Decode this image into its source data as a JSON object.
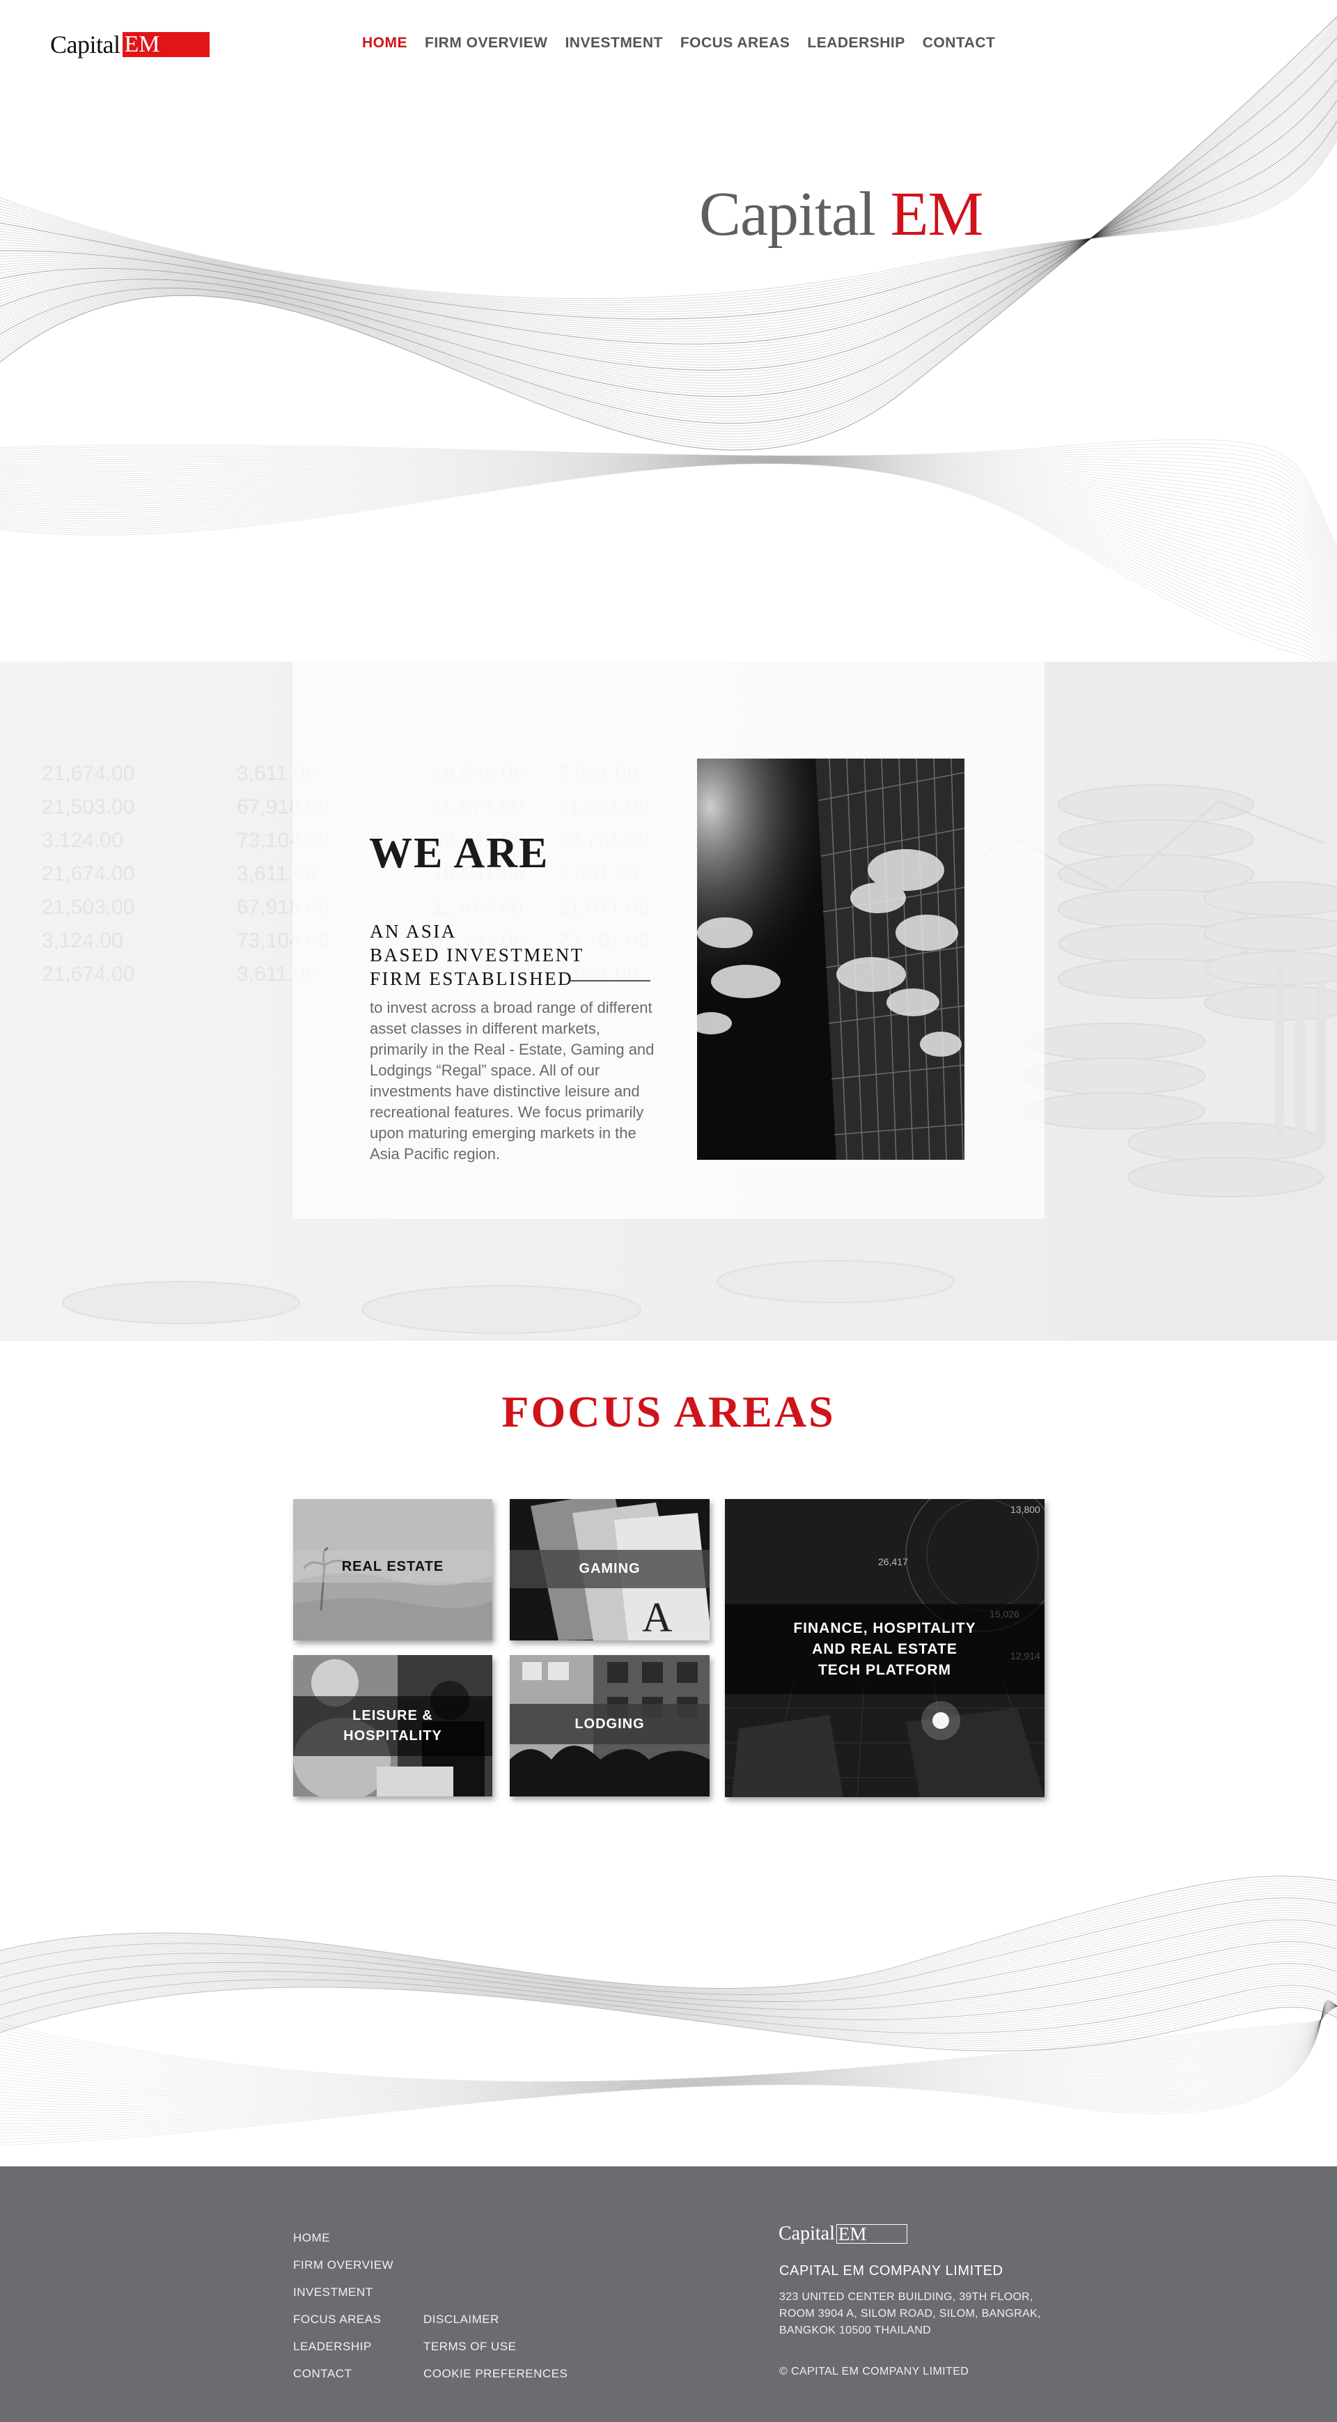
{
  "brand": {
    "word": "Capital",
    "mark": "EM",
    "accent_color": "#d0121a"
  },
  "nav": {
    "items": [
      {
        "label": "HOME",
        "active": true
      },
      {
        "label": "FIRM OVERVIEW",
        "active": false
      },
      {
        "label": "INVESTMENT",
        "active": false
      },
      {
        "label": "FOCUS AREAS",
        "active": false
      },
      {
        "label": "LEADERSHIP",
        "active": false
      },
      {
        "label": "CONTACT",
        "active": false
      }
    ]
  },
  "hero": {
    "title_word": "Capital",
    "title_mark": "EM"
  },
  "weare": {
    "title": "WE ARE",
    "sub_lines": [
      "AN  ASIA",
      "BASED  INVESTMENT",
      "FIRM  ESTABLISHED"
    ],
    "body": "to invest across a broad range of different asset classes in different markets, primarily in the Real - Estate, Gaming and Lodgings “Regal” space. All of our investments have distinctive leisure and   recreational features. We focus primarily upon maturing emerging markets in the Asia Pacific region.",
    "bg_numbers": [
      "21,674.00",
      "3,611.00",
      "18,541.00",
      "5,061.00",
      "21,503.00",
      "67,918.00",
      "11,674.00",
      "21,871.00",
      "3,124.00",
      "73,104.00",
      "52,441.00",
      "23,761.00"
    ]
  },
  "focus": {
    "heading": "FOCUS  AREAS",
    "tiles": [
      {
        "label": "REAL  ESTATE"
      },
      {
        "label": "GAMING"
      },
      {
        "label": "FINANCE, HOSPITALITY\nAND REAL ESTATE\nTECH PLATFORM"
      },
      {
        "label": "LEISURE  &\nHOSPITALITY"
      },
      {
        "label": "LODGING"
      }
    ],
    "chart_ticks": [
      "26,417",
      "13,800",
      "12,914",
      "15,026"
    ]
  },
  "footer": {
    "links_left": [
      "HOME",
      "FIRM OVERVIEW",
      "INVESTMENT",
      "FOCUS AREAS",
      "LEADERSHIP",
      "CONTACT"
    ],
    "links_right": [
      "DISCLAIMER",
      "TERMS OF USE",
      "COOKIE PREFERENCES"
    ],
    "logo_word": "Capital",
    "logo_mark": "EM",
    "company": "CAPITAL EM COMPANY LIMITED",
    "address": "323 UNITED CENTER BUILDING, 39TH FLOOR, ROOM 3904 A, SILOM ROAD, SILOM, BANGRAK, BANGKOK 10500 THAILAND",
    "copyright": "© CAPITAL EM COMPANY LIMITED"
  }
}
